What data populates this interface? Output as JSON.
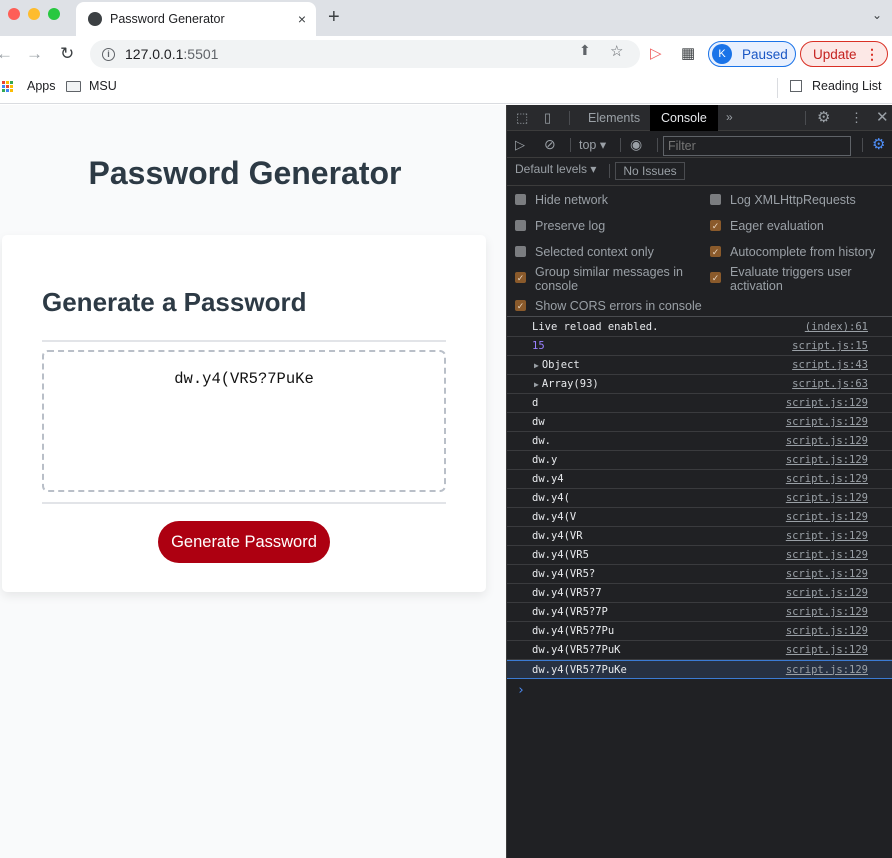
{
  "browser": {
    "tab_title": "Password Generator",
    "tab_close": "×",
    "new_tab": "+",
    "url_host": "127.0.0.1",
    "url_port": ":5501",
    "profile_initial": "K",
    "profile_status": "Paused",
    "update_label": "Update",
    "bookmarks": [
      {
        "label": "Apps",
        "icon": "apps-grid-icon"
      },
      {
        "label": "MSU",
        "icon": "folder-icon"
      }
    ],
    "reading_list": "Reading List"
  },
  "page": {
    "title": "Password Generator",
    "card_title": "Generate a Password",
    "password": "dw.y4(VR5?7PuKe",
    "generate_button": "Generate Password",
    "button_color": "#ad0011"
  },
  "devtools": {
    "tabs": [
      {
        "label": "Elements",
        "active": false
      },
      {
        "label": "Console",
        "active": true
      }
    ],
    "more_tabs": "»",
    "context": "top",
    "filter_placeholder": "Filter",
    "levels": "Default levels",
    "issues": "No Issues",
    "settings_left": [
      {
        "label": "Hide network",
        "checked": false
      },
      {
        "label": "Preserve log",
        "checked": false
      },
      {
        "label": "Selected context only",
        "checked": false
      },
      {
        "label": "Group similar messages in console",
        "checked": true
      },
      {
        "label": "Show CORS errors in console",
        "checked": true
      }
    ],
    "settings_right": [
      {
        "label": "Log XMLHttpRequests",
        "checked": false
      },
      {
        "label": "Eager evaluation",
        "checked": true
      },
      {
        "label": "Autocomplete from history",
        "checked": true
      },
      {
        "label": "Evaluate triggers user activation",
        "checked": true
      }
    ],
    "console": [
      {
        "msg": "Live reload enabled.",
        "src": "(index):61"
      },
      {
        "msg": "15",
        "src": "script.js:15",
        "type": "number"
      },
      {
        "msg": "Object",
        "src": "script.js:43",
        "expandable": true
      },
      {
        "msg": "Array(93)",
        "src": "script.js:63",
        "expandable": true
      },
      {
        "msg": "d",
        "src": "script.js:129"
      },
      {
        "msg": "dw",
        "src": "script.js:129"
      },
      {
        "msg": "dw.",
        "src": "script.js:129"
      },
      {
        "msg": "dw.y",
        "src": "script.js:129"
      },
      {
        "msg": "dw.y4",
        "src": "script.js:129"
      },
      {
        "msg": "dw.y4(",
        "src": "script.js:129"
      },
      {
        "msg": "dw.y4(V",
        "src": "script.js:129"
      },
      {
        "msg": "dw.y4(VR",
        "src": "script.js:129"
      },
      {
        "msg": "dw.y4(VR5",
        "src": "script.js:129"
      },
      {
        "msg": "dw.y4(VR5?",
        "src": "script.js:129"
      },
      {
        "msg": "dw.y4(VR5?7",
        "src": "script.js:129"
      },
      {
        "msg": "dw.y4(VR5?7P",
        "src": "script.js:129"
      },
      {
        "msg": "dw.y4(VR5?7Pu",
        "src": "script.js:129"
      },
      {
        "msg": "dw.y4(VR5?7PuK",
        "src": "script.js:129"
      },
      {
        "msg": "dw.y4(VR5?7PuKe",
        "src": "script.js:129",
        "selected": true
      }
    ],
    "prompt": "›"
  }
}
